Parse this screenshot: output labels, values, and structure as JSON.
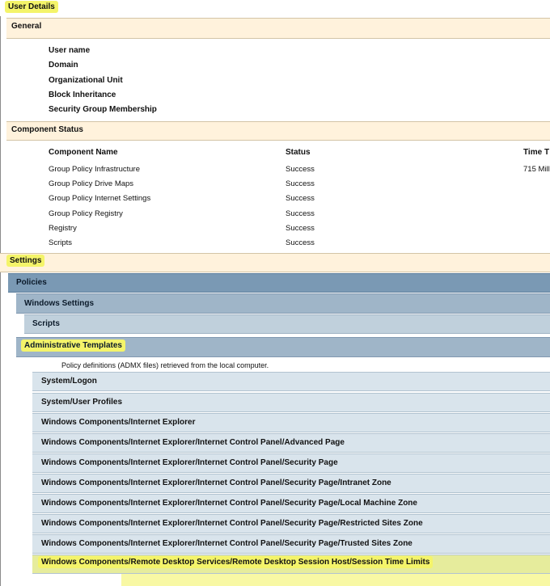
{
  "user_details": {
    "title": "User Details",
    "general": {
      "title": "General",
      "fields": [
        "User name",
        "Domain",
        "Organizational Unit",
        "Block Inheritance",
        "Security Group Membership"
      ]
    },
    "component_status": {
      "title": "Component Status",
      "headers": [
        "Component Name",
        "Status",
        "Time T"
      ],
      "rows": [
        {
          "name": "Group Policy Infrastructure",
          "status": "Success",
          "time": "715 Mill"
        },
        {
          "name": "Group Policy Drive Maps",
          "status": "Success",
          "time": ""
        },
        {
          "name": "Group Policy Internet Settings",
          "status": "Success",
          "time": ""
        },
        {
          "name": "Group Policy Registry",
          "status": "Success",
          "time": ""
        },
        {
          "name": "Registry",
          "status": "Success",
          "time": ""
        },
        {
          "name": "Scripts",
          "status": "Success",
          "time": ""
        }
      ]
    }
  },
  "settings": {
    "title": "Settings",
    "policies": "Policies",
    "windows_settings": "Windows Settings",
    "scripts": "Scripts",
    "admin_templates": "Administrative Templates",
    "admx_note": "Policy definitions (ADMX files) retrieved from the local computer.",
    "template_sections": [
      "System/Logon",
      "System/User Profiles",
      "Windows Components/Internet Explorer",
      "Windows Components/Internet Explorer/Internet Control Panel/Advanced Page",
      "Windows Components/Internet Explorer/Internet Control Panel/Security Page",
      "Windows Components/Internet Explorer/Internet Control Panel/Security Page/Intranet Zone",
      "Windows Components/Internet Explorer/Internet Control Panel/Security Page/Local Machine Zone",
      "Windows Components/Internet Explorer/Internet Control Panel/Security Page/Restricted Sites Zone",
      "Windows Components/Internet Explorer/Internet Control Panel/Security Page/Trusted Sites Zone",
      "Windows Components/Remote Desktop Services/Remote Desktop Session Host/Session Time Limits"
    ]
  },
  "colors": {
    "tan_header": "#fff2dc",
    "policies_band": "#7a99b4",
    "windows_settings_band": "#9fb5c8",
    "section_band": "#c0d0dc",
    "subsection_band": "#d9e4ec",
    "highlight": "#f4f46a"
  }
}
